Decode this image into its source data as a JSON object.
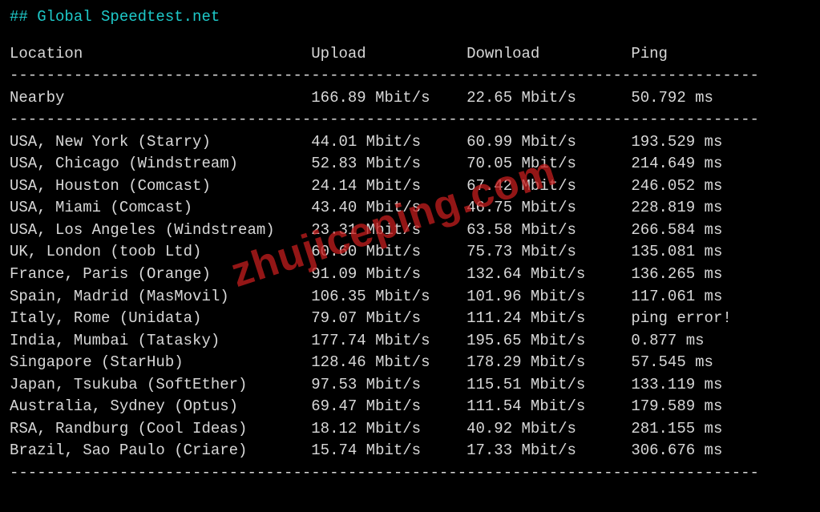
{
  "title": "## Global Speedtest.net",
  "headers": {
    "location": "Location",
    "upload": "Upload",
    "download": "Download",
    "ping": "Ping"
  },
  "nearby": {
    "location": "Nearby",
    "upload": "166.89 Mbit/s",
    "download": "22.65 Mbit/s",
    "ping": "50.792 ms"
  },
  "rows": [
    {
      "location": "USA, New York (Starry)",
      "upload": "44.01 Mbit/s",
      "download": "60.99 Mbit/s",
      "ping": "193.529 ms"
    },
    {
      "location": "USA, Chicago (Windstream)",
      "upload": "52.83 Mbit/s",
      "download": "70.05 Mbit/s",
      "ping": "214.649 ms"
    },
    {
      "location": "USA, Houston (Comcast)",
      "upload": "24.14 Mbit/s",
      "download": "67.42 Mbit/s",
      "ping": "246.052 ms"
    },
    {
      "location": "USA, Miami (Comcast)",
      "upload": "43.40 Mbit/s",
      "download": "46.75 Mbit/s",
      "ping": "228.819 ms"
    },
    {
      "location": "USA, Los Angeles (Windstream)",
      "upload": "23.31 Mbit/s",
      "download": "63.58 Mbit/s",
      "ping": "266.584 ms"
    },
    {
      "location": "UK, London (toob Ltd)",
      "upload": "60.60 Mbit/s",
      "download": "75.73 Mbit/s",
      "ping": "135.081 ms"
    },
    {
      "location": "France, Paris (Orange)",
      "upload": "91.09 Mbit/s",
      "download": "132.64 Mbit/s",
      "ping": "136.265 ms"
    },
    {
      "location": "Spain, Madrid (MasMovil)",
      "upload": "106.35 Mbit/s",
      "download": "101.96 Mbit/s",
      "ping": "117.061 ms"
    },
    {
      "location": "Italy, Rome (Unidata)",
      "upload": "79.07 Mbit/s",
      "download": "111.24 Mbit/s",
      "ping": "ping error!"
    },
    {
      "location": "India, Mumbai (Tatasky)",
      "upload": "177.74 Mbit/s",
      "download": "195.65 Mbit/s",
      "ping": "0.877 ms"
    },
    {
      "location": "Singapore (StarHub)",
      "upload": "128.46 Mbit/s",
      "download": "178.29 Mbit/s",
      "ping": "57.545 ms"
    },
    {
      "location": "Japan, Tsukuba (SoftEther)",
      "upload": "97.53 Mbit/s",
      "download": "115.51 Mbit/s",
      "ping": "133.119 ms"
    },
    {
      "location": "Australia, Sydney (Optus)",
      "upload": "69.47 Mbit/s",
      "download": "111.54 Mbit/s",
      "ping": "179.589 ms"
    },
    {
      "location": "RSA, Randburg (Cool Ideas)",
      "upload": "18.12 Mbit/s",
      "download": "40.92 Mbit/s",
      "ping": "281.155 ms"
    },
    {
      "location": "Brazil, Sao Paulo (Criare)",
      "upload": "15.74 Mbit/s",
      "download": "17.33 Mbit/s",
      "ping": "306.676 ms"
    }
  ],
  "watermark": "zhujiceping.com",
  "divider": "----------------------------------------------------------------------------------"
}
